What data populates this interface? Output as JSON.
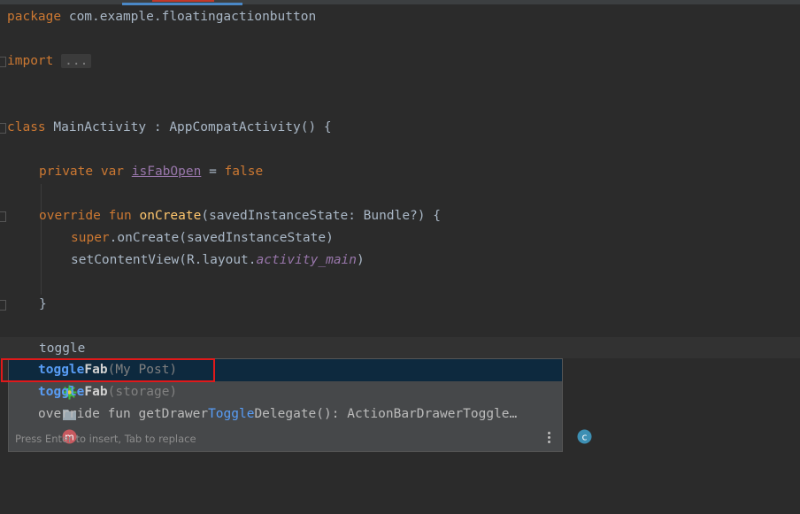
{
  "code": {
    "l1_kw": "package",
    "l1_rest": " com.example.floatingactionbutton",
    "l2_kw": "import",
    "l2_fold": "...",
    "l3_kw": "class",
    "l3_rest": " MainActivity : AppCompatActivity() {",
    "l4_kw1": "private",
    "l4_kw2": " var ",
    "l4_prop": "isFabOpen",
    "l4_eq": " = ",
    "l4_val": "false",
    "l5_kw1": "override",
    "l5_kw2": " fun ",
    "l5_fn": "onCreate",
    "l5_rest": "(savedInstanceState: Bundle?) {",
    "l6_kw": "super",
    "l6_rest": ".onCreate(savedInstanceState)",
    "l7_a": "setContentView(R.layout.",
    "l7_ital": "activity_main",
    "l7_b": ")",
    "l8": "}",
    "l9": "toggle"
  },
  "popup": {
    "items": [
      {
        "match": "toggle",
        "rest": "Fab",
        "detail": "(My Post)",
        "icon": "kotlin-function-icon"
      },
      {
        "match": "toggle",
        "rest": "Fab",
        "detail": "(storage)",
        "icon": "folder-icon"
      },
      {
        "prefix": "override fun getDrawer",
        "match": "Toggle",
        "rest": "Delegate(): ActionBarDrawerToggle…",
        "icon": "method-icon",
        "badge": "c"
      }
    ],
    "footer": "Press Enter to insert, Tab to replace"
  },
  "colors": {
    "background": "#2b2b2b",
    "keyword": "#cc7832",
    "function": "#ffc66d",
    "property": "#9876aa",
    "highlight": "#589df6",
    "selection_box": "#e0191a"
  }
}
